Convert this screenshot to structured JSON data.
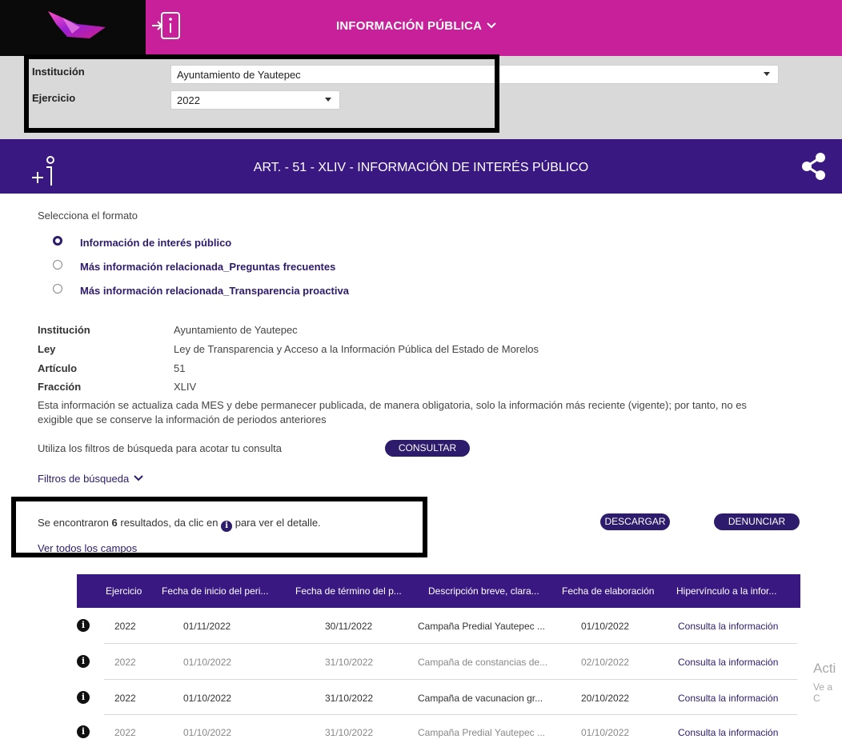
{
  "header": {
    "title": "INFORMACIÓN PÚBLICA",
    "chevron": "⌄",
    "entry_icon": "login-info-icon",
    "logo": "brand-logo"
  },
  "filters": {
    "institucion_label": "Institución",
    "institucion_value": "Ayuntamiento de Yautepec",
    "ejercicio_label": "Ejercicio",
    "ejercicio_value": "2022"
  },
  "section": {
    "title": "ART. - 51 - XLIV - INFORMACIÓN DE INTERÉS PÚBLICO",
    "icon": "plus-info-icon",
    "share_icon": "share-icon"
  },
  "formato": {
    "prompt": "Selecciona el formato",
    "options": [
      {
        "label": "Información de interés público",
        "selected": true
      },
      {
        "label": "Más información relacionada_Preguntas frecuentes",
        "selected": false
      },
      {
        "label": "Más información relacionada_Transparencia proactiva",
        "selected": false
      }
    ]
  },
  "details": {
    "institucion_key": "Institución",
    "institucion_val": "Ayuntamiento de Yautepec",
    "ley_key": "Ley",
    "ley_val": "Ley de Transparencia y Acceso a la Información Pública del Estado de Morelos",
    "articulo_key": "Artículo",
    "articulo_val": "51",
    "fraccion_key": "Fracción",
    "fraccion_val": "XLIV",
    "nota": "Esta información se actualiza cada MES y debe permanecer publicada, de manera obligatoria, solo la información más reciente (vigente); por tanto, no es exigible que se conserve la información de periodos anteriores"
  },
  "consulta": {
    "hint": "Utiliza los filtros de búsqueda para acotar tu consulta",
    "button": "CONSULTAR"
  },
  "filtros_busqueda": "Filtros de búsqueda",
  "results": {
    "prefix": "Se encontraron ",
    "count": "6",
    "suffix": " resultados, da clic en ",
    "suffix2": " para ver el detalle.",
    "ver_todos": "Ver todos los campos",
    "descargar": "DESCARGAR",
    "denunciar": "DENUNCIAR"
  },
  "table": {
    "headers": [
      "Ejercicio",
      "Fecha de inicio del peri...",
      "Fecha de término del p...",
      "Descripción breve, clara...",
      "Fecha de elaboración",
      "Hipervínculo a la infor..."
    ],
    "rows": [
      {
        "ejercicio": "2022",
        "inicio": "01/11/2022",
        "termino": "30/11/2022",
        "descripcion": "Campaña Predial Yautepec ...",
        "elaboracion": "01/10/2022",
        "link": "Consulta la información",
        "dim": false
      },
      {
        "ejercicio": "2022",
        "inicio": "01/10/2022",
        "termino": "31/10/2022",
        "descripcion": "Campaña de constancias de...",
        "elaboracion": "02/10/2022",
        "link": "Consulta la información",
        "dim": true
      },
      {
        "ejercicio": "2022",
        "inicio": "01/10/2022",
        "termino": "31/10/2022",
        "descripcion": "Campaña de vacunacion gr...",
        "elaboracion": "20/10/2022",
        "link": "Consulta la información",
        "dim": false
      },
      {
        "ejercicio": "2022",
        "inicio": "01/10/2022",
        "termino": "31/10/2022",
        "descripcion": "Campaña Predial Yautepec ...",
        "elaboracion": "01/10/2022",
        "link": "Consulta la información",
        "dim": true
      }
    ]
  },
  "watermark": {
    "line1": "Acti",
    "line2": "Ve a C"
  },
  "colors": {
    "brand_magenta": "#c8209a",
    "brand_purple": "#3a1882",
    "panel_gray": "#d9d9d9"
  }
}
